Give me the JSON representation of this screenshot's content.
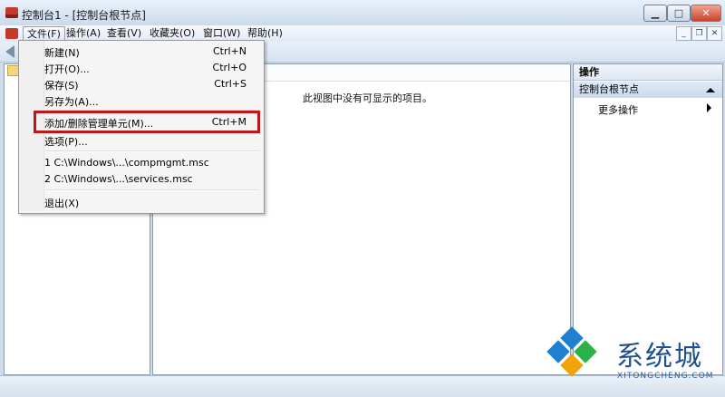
{
  "window": {
    "title": "控制台1 - [控制台根节点]",
    "buttons": {
      "minimize": "▁",
      "maximize": "□",
      "close": "✕"
    }
  },
  "menubar": {
    "items": [
      "文件(F)",
      "操作(A)",
      "查看(V)",
      "收藏夹(O)",
      "窗口(W)",
      "帮助(H)"
    ],
    "active_index": 0,
    "mdi_buttons": {
      "minimize": "_",
      "restore": "❐",
      "close": "✕"
    }
  },
  "main": {
    "empty_message": "此视图中没有可显示的项目。"
  },
  "actions_pane": {
    "title": "操作",
    "section": "控制台根节点",
    "more_actions": "更多操作"
  },
  "file_menu": {
    "items": [
      {
        "label": "新建(N)",
        "shortcut": "Ctrl+N"
      },
      {
        "label": "打开(O)...",
        "shortcut": "Ctrl+O"
      },
      {
        "label": "保存(S)",
        "shortcut": "Ctrl+S"
      },
      {
        "label": "另存为(A)...",
        "shortcut": ""
      },
      {
        "label": "添加/删除管理单元(M)...",
        "shortcut": "Ctrl+M"
      },
      {
        "label": "选项(P)...",
        "shortcut": ""
      },
      {
        "label": "1 C:\\Windows\\...\\compmgmt.msc",
        "shortcut": ""
      },
      {
        "label": "2 C:\\Windows\\...\\services.msc",
        "shortcut": ""
      },
      {
        "label": "退出(X)",
        "shortcut": ""
      }
    ],
    "highlighted_index": 4,
    "highlight_color": "#c0171b"
  },
  "watermark": {
    "text": "系统城",
    "subtext": "XITONGCHENG.COM",
    "colors": [
      "#1f7fd0",
      "#2cb24a",
      "#f0a30a",
      "#1f4f8f"
    ]
  }
}
